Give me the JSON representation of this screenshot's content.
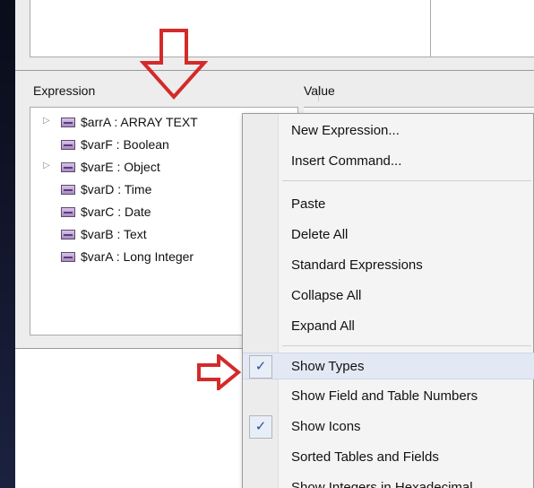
{
  "columns": {
    "expression": "Expression",
    "value": "Value"
  },
  "tree": [
    {
      "label": "$arrA : ARRAY TEXT",
      "expandable": true
    },
    {
      "label": "$varF : Boolean",
      "expandable": false
    },
    {
      "label": "$varE : Object",
      "expandable": true
    },
    {
      "label": "$varD : Time",
      "expandable": false
    },
    {
      "label": "$varC : Date",
      "expandable": false
    },
    {
      "label": "$varB : Text",
      "expandable": false
    },
    {
      "label": "$varA : Long Integer",
      "expandable": false
    }
  ],
  "context_menu": {
    "items": [
      {
        "label": "New Expression...",
        "checked": false
      },
      {
        "label": "Insert Command...",
        "checked": false
      },
      {
        "label": "Paste",
        "checked": false
      },
      {
        "label": "Delete All",
        "checked": false
      },
      {
        "label": "Standard Expressions",
        "checked": false
      },
      {
        "label": "Collapse All",
        "checked": false
      },
      {
        "label": "Expand All",
        "checked": false
      },
      {
        "label": "Show Types",
        "checked": true
      },
      {
        "label": "Show Field and Table Numbers",
        "checked": false
      },
      {
        "label": "Show Icons",
        "checked": true
      },
      {
        "label": "Sorted Tables and Fields",
        "checked": false
      },
      {
        "label": "Show Integers in Hexadecimal",
        "checked": false
      }
    ],
    "check_glyph": "✓"
  },
  "colors": {
    "annotation_red": "#d42a2a",
    "check_blue": "#2a4d9c"
  },
  "icons": {
    "expand": "expand-triangle-icon",
    "variable": "variable-icon",
    "annotation_down": "red-down-arrow-icon",
    "annotation_right": "red-right-arrow-icon"
  }
}
